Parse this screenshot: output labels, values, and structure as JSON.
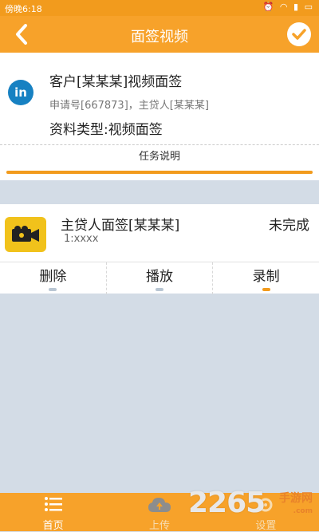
{
  "statusbar": {
    "time": "傍晚6:18"
  },
  "header": {
    "title": "面签视频"
  },
  "customer_card": {
    "badge": "in",
    "title": "客户[某某某]视频面签",
    "subtitle": "申请号[667873]，主贷人[某某某]",
    "material_type": "资料类型:视频面签",
    "task_button": "任务说明",
    "progress": 1.0
  },
  "video_item": {
    "title": "主贷人面签[某某某]",
    "status": "未完成",
    "subtitle": "1:xxxx",
    "actions": [
      {
        "label": "删除"
      },
      {
        "label": "播放"
      },
      {
        "label": "录制"
      }
    ]
  },
  "tabbar": {
    "items": [
      {
        "label": "首页",
        "icon": "list-icon"
      },
      {
        "label": "上传",
        "icon": "cloud-upload-icon"
      },
      {
        "label": "设置",
        "icon": "gear-icon"
      }
    ]
  },
  "watermark": {
    "number": "2265",
    "brand": "手游网",
    "url": ".com"
  },
  "colors": {
    "accent": "#f7a22a",
    "background": "#d3dce6"
  }
}
